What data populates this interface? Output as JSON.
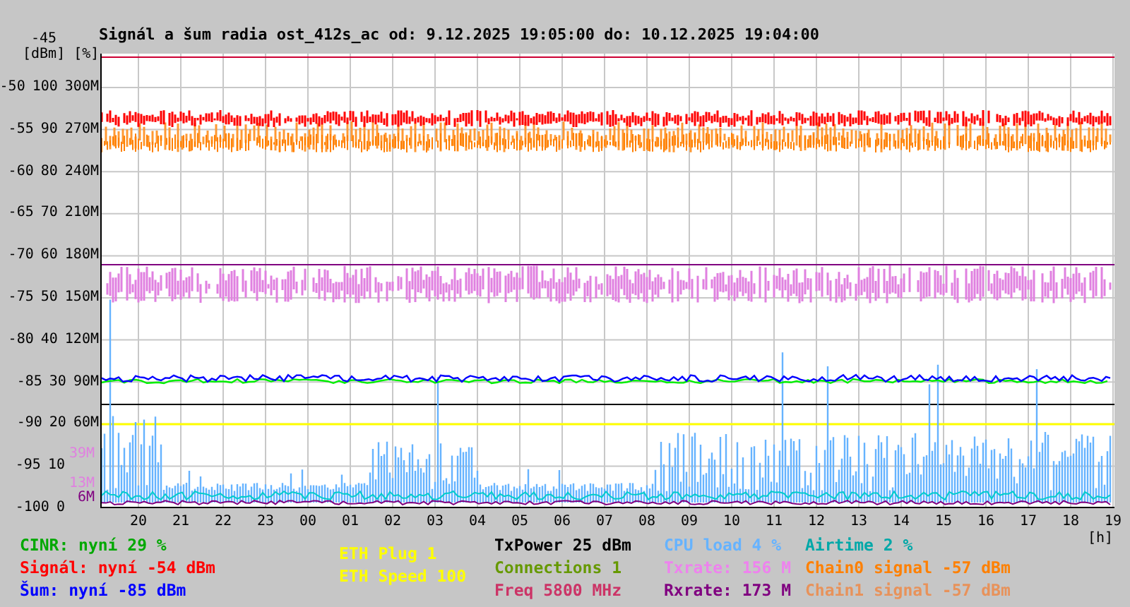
{
  "title": "Signál a šum radia ost_412s_ac od: 9.12.2025 19:05:00 do: 10.12.2025 19:04:00",
  "y_axis": {
    "top_label": "-45",
    "units": "[dBm] [%]",
    "rows": [
      {
        "dbm": "-50",
        "percent": "100",
        "rate": "300M"
      },
      {
        "dbm": "-55",
        "percent": "90",
        "rate": "270M"
      },
      {
        "dbm": "-60",
        "percent": "80",
        "rate": "240M"
      },
      {
        "dbm": "-65",
        "percent": "70",
        "rate": "210M"
      },
      {
        "dbm": "-70",
        "percent": "60",
        "rate": "180M"
      },
      {
        "dbm": "-75",
        "percent": "50",
        "rate": "150M"
      },
      {
        "dbm": "-80",
        "percent": "40",
        "rate": "120M"
      },
      {
        "dbm": "-85",
        "percent": "30",
        "rate": "90M"
      },
      {
        "dbm": "-90",
        "percent": "20",
        "rate": "60M"
      },
      {
        "dbm": "-95",
        "percent": "10"
      },
      {
        "dbm": "-100",
        "percent": "0"
      }
    ],
    "markers": [
      {
        "text": "39M",
        "color": "#e080e0"
      },
      {
        "text": "13M",
        "color": "#e080e0"
      },
      {
        "text": "6M",
        "color": "#800080"
      }
    ]
  },
  "x_axis": {
    "labels": [
      "20",
      "21",
      "22",
      "23",
      "00",
      "01",
      "02",
      "03",
      "04",
      "05",
      "06",
      "07",
      "08",
      "09",
      "10",
      "11",
      "12",
      "13",
      "14",
      "15",
      "16",
      "17",
      "18",
      "19"
    ],
    "unit": "[h]"
  },
  "legend": [
    [
      {
        "text": "CINR: nyní 29 %",
        "color": "#00a800"
      },
      {
        "text": "Signál: nyní -54 dBm",
        "color": "#ff0000"
      },
      {
        "text": "Šum: nyní -85 dBm",
        "color": "#0000ff"
      }
    ],
    [
      {
        "text": "ETH Plug 1",
        "color": "#ffff00"
      },
      {
        "text": "ETH Speed 100",
        "color": "#ffff00"
      }
    ],
    [
      {
        "text": "TxPower 25 dBm",
        "color": "#000000"
      },
      {
        "text": "Connections 1",
        "color": "#669900"
      },
      {
        "text": "Freq 5800 MHz",
        "color": "#cc3366"
      }
    ],
    [
      {
        "text": "CPU load 4 %",
        "color": "#66b3ff"
      },
      {
        "text": "Txrate: 156 M",
        "color": "#ee82ee"
      },
      {
        "text": "Rxrate: 173 M",
        "color": "#800080"
      }
    ],
    [
      {
        "text": "Airtime 2 %",
        "color": "#00a8a8"
      },
      {
        "text": "Chain0 signal -57 dBm",
        "color": "#ff8000"
      },
      {
        "text": "Chain1 signal -57 dBm",
        "color": "#e8925a"
      }
    ]
  ]
}
